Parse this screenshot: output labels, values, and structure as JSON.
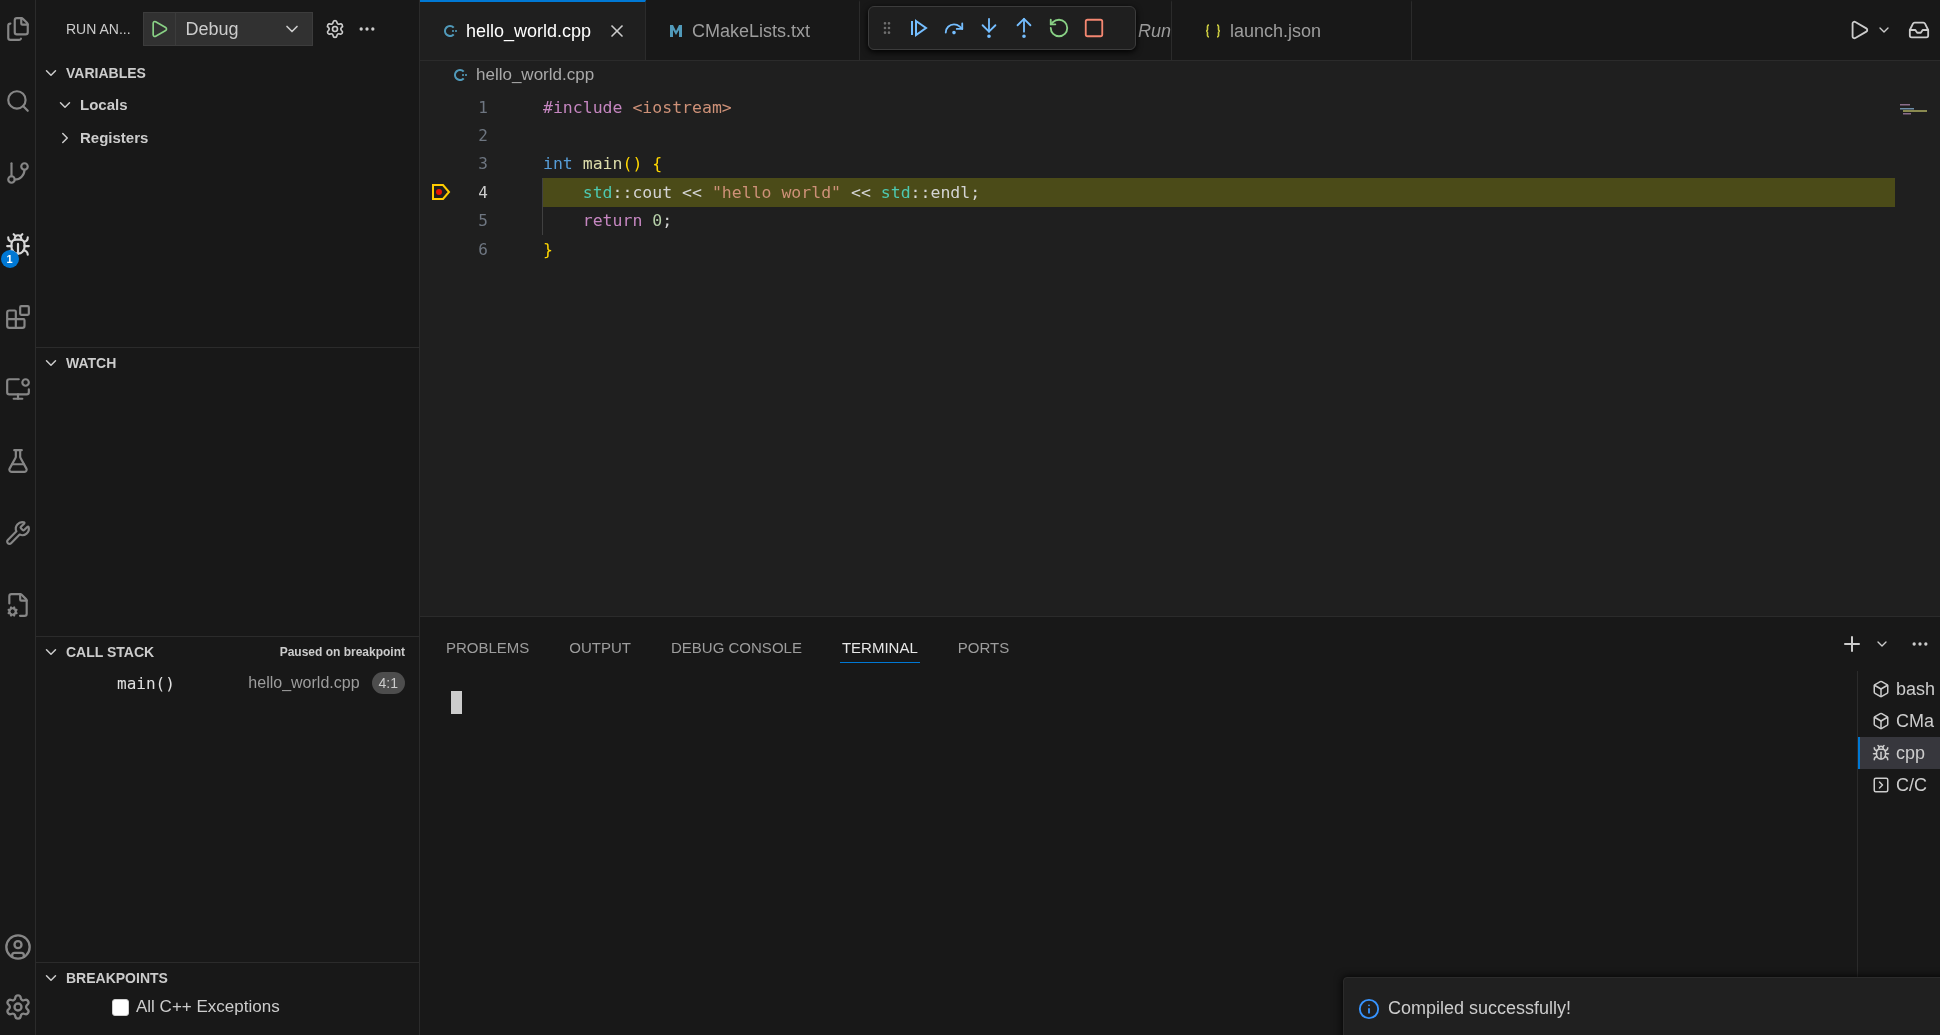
{
  "activity_bar": {
    "debug_badge": "1"
  },
  "sidebar": {
    "title": "RUN AN...",
    "config": "Debug",
    "sections": [
      {
        "kind": "variables",
        "title": "VARIABLES",
        "expanded": true,
        "items": [
          {
            "label": "Locals",
            "expanded": true
          },
          {
            "label": "Registers",
            "expanded": false
          }
        ]
      },
      {
        "kind": "watch",
        "title": "WATCH",
        "expanded": true
      },
      {
        "kind": "callstack",
        "title": "CALL STACK",
        "expanded": true,
        "status": "Paused on breakpoint",
        "frames": [
          {
            "function": "main()",
            "file": "hello_world.cpp",
            "position": "4:1"
          }
        ]
      },
      {
        "kind": "breakpoints",
        "title": "BREAKPOINTS",
        "expanded": true,
        "items": [
          {
            "label": "All C++ Exceptions",
            "checked": false
          }
        ]
      }
    ]
  },
  "tabs": [
    {
      "label": "hello_world.cpp",
      "kind": "cpp",
      "selected": true,
      "preview": false
    },
    {
      "label": "CMakeLists.txt",
      "kind": "cmake",
      "selected": false,
      "preview": false
    },
    {
      "label": "Run",
      "kind": "covered",
      "selected": false,
      "preview": true
    },
    {
      "label": "launch.json",
      "kind": "json",
      "selected": false,
      "preview": false
    }
  ],
  "breadcrumb": "hello_world.cpp",
  "code": [
    {
      "number": "1",
      "current": false,
      "tokens": [
        {
          "color": "#c586c0",
          "text": "#include"
        },
        {
          "color": "#ce9178",
          "text": " <iostream>"
        }
      ]
    },
    {
      "number": "2",
      "current": false
    },
    {
      "number": "3",
      "current": false,
      "tokens": [
        {
          "color": "#569cd6",
          "text": "int"
        },
        {
          "color": "#dcdcaa",
          "text": " main"
        },
        {
          "color": "#ffd700",
          "text": "() {"
        }
      ]
    },
    {
      "number": "4",
      "current": true,
      "tokens": [
        {
          "color": "#4ec9b0",
          "text": "    std"
        },
        {
          "color": "#d4d4d4",
          "text": "::cout << "
        },
        {
          "color": "#ce9178",
          "text": "\"hello world\""
        },
        {
          "color": "#d4d4d4",
          "text": " << "
        },
        {
          "color": "#4ec9b0",
          "text": "std"
        },
        {
          "color": "#d4d4d4",
          "text": "::endl;"
        }
      ]
    },
    {
      "number": "5",
      "current": false,
      "tokens": [
        {
          "color": "#c586c0",
          "text": "    return"
        },
        {
          "color": "#b5cea8",
          "text": " 0"
        },
        {
          "color": "#d4d4d4",
          "text": ";"
        }
      ]
    },
    {
      "number": "6",
      "current": false,
      "tokens": [
        {
          "color": "#ffd700",
          "text": "}"
        }
      ]
    }
  ],
  "panel": {
    "tabs": [
      {
        "label": "PROBLEMS",
        "selected": false
      },
      {
        "label": "OUTPUT",
        "selected": false
      },
      {
        "label": "DEBUG CONSOLE",
        "selected": false
      },
      {
        "label": "TERMINAL",
        "selected": true
      },
      {
        "label": "PORTS",
        "selected": false
      }
    ],
    "terminals": [
      {
        "label": "bash",
        "kind": "shell",
        "selected": false
      },
      {
        "label": "CMa",
        "kind": "shell",
        "selected": false
      },
      {
        "label": "cpp",
        "kind": "debug",
        "selected": true
      },
      {
        "label": "C/C",
        "kind": "task",
        "selected": false
      }
    ]
  },
  "notification": {
    "message": "Compiled successfully!"
  }
}
